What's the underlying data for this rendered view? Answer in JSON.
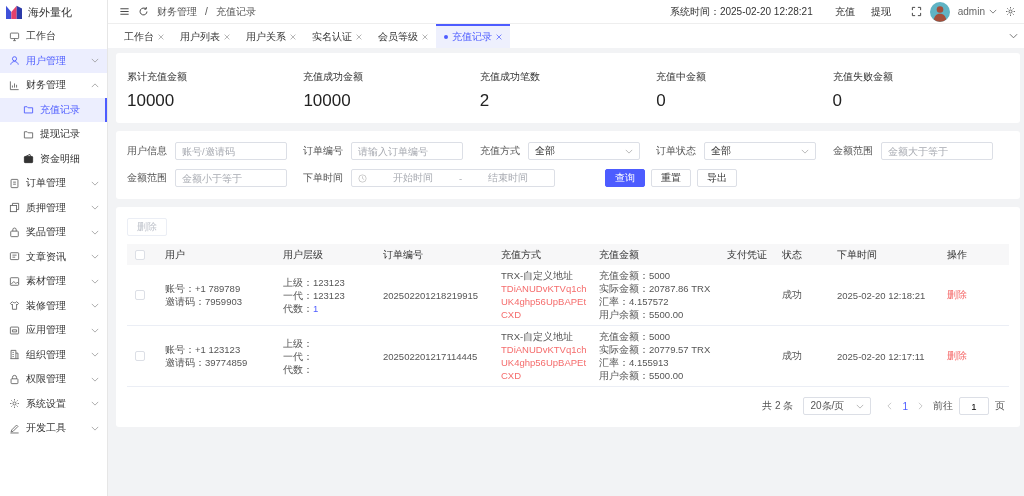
{
  "app": {
    "name": "海外量化"
  },
  "sidebar": {
    "items": [
      {
        "label": "工作台",
        "kind": "link",
        "selected": false,
        "hovered": false
      },
      {
        "label": "用户管理",
        "kind": "group",
        "selected": false,
        "hovered": true,
        "expanded": false
      },
      {
        "label": "财务管理",
        "kind": "group",
        "selected": false,
        "hovered": false,
        "expanded": true,
        "children": [
          {
            "label": "充值记录",
            "selected": true
          },
          {
            "label": "提现记录",
            "selected": false
          },
          {
            "label": "资金明细",
            "selected": false
          }
        ]
      },
      {
        "label": "订单管理",
        "kind": "group",
        "selected": false,
        "hovered": false,
        "expanded": false
      },
      {
        "label": "质押管理",
        "kind": "group",
        "selected": false,
        "hovered": false,
        "expanded": false
      },
      {
        "label": "奖品管理",
        "kind": "group",
        "selected": false,
        "hovered": false,
        "expanded": false
      },
      {
        "label": "文章资讯",
        "kind": "group",
        "selected": false,
        "hovered": false,
        "expanded": false
      },
      {
        "label": "素材管理",
        "kind": "group",
        "selected": false,
        "hovered": false,
        "expanded": false
      },
      {
        "label": "装修管理",
        "kind": "group",
        "selected": false,
        "hovered": false,
        "expanded": false
      },
      {
        "label": "应用管理",
        "kind": "group",
        "selected": false,
        "hovered": false,
        "expanded": false
      },
      {
        "label": "组织管理",
        "kind": "group",
        "selected": false,
        "hovered": false,
        "expanded": false
      },
      {
        "label": "权限管理",
        "kind": "group",
        "selected": false,
        "hovered": false,
        "expanded": false
      },
      {
        "label": "系统设置",
        "kind": "group",
        "selected": false,
        "hovered": false,
        "expanded": false
      },
      {
        "label": "开发工具",
        "kind": "group",
        "selected": false,
        "hovered": false,
        "expanded": false
      }
    ]
  },
  "header": {
    "breadcrumb": [
      "财务管理",
      "/",
      "充值记录"
    ],
    "system_time": "系统时间：2025-02-20 12:28:21",
    "links": [
      "充值",
      "提现"
    ],
    "user": "admin"
  },
  "tabs": [
    {
      "label": "工作台",
      "selected": false
    },
    {
      "label": "用户列表",
      "selected": false
    },
    {
      "label": "用户关系",
      "selected": false
    },
    {
      "label": "实名认证",
      "selected": false
    },
    {
      "label": "会员等级",
      "selected": false
    },
    {
      "label": "充值记录",
      "selected": true
    }
  ],
  "stats": [
    {
      "label": "累计充值金额",
      "value": "10000"
    },
    {
      "label": "充值成功金额",
      "value": "10000"
    },
    {
      "label": "充值成功笔数",
      "value": "2"
    },
    {
      "label": "充值中金额",
      "value": "0"
    },
    {
      "label": "充值失败金额",
      "value": "0"
    }
  ],
  "filters": {
    "row_1": [
      {
        "label": "用户信息",
        "kind": "input",
        "placeholder": "账号/邀请码"
      },
      {
        "label": "订单编号",
        "kind": "input",
        "placeholder": "请输入订单编号"
      },
      {
        "label": "充值方式",
        "kind": "select",
        "value": "全部"
      },
      {
        "label": "订单状态",
        "kind": "select",
        "value": "全部"
      },
      {
        "label": "金额范围",
        "kind": "input",
        "placeholder": "金额大于等于"
      }
    ],
    "row_2": [
      {
        "label": "金额范围",
        "kind": "input",
        "placeholder": "金额小于等于"
      },
      {
        "label": "下单时间",
        "kind": "daterange",
        "start_placeholder": "开始时间",
        "separator": "-",
        "end_placeholder": "结束时间"
      }
    ],
    "buttons": [
      {
        "label": "查询",
        "kind": "primary"
      },
      {
        "label": "重置",
        "kind": "default"
      },
      {
        "label": "导出",
        "kind": "default"
      }
    ]
  },
  "table": {
    "delete_button": {
      "label": "删除",
      "disabled": true
    },
    "select_all": {
      "checked": false
    },
    "columns": [
      "用户",
      "用户层级",
      "订单编号",
      "充值方式",
      "充值金额",
      "支付凭证",
      "状态",
      "下单时间",
      "操作"
    ],
    "rows": [
      {
        "checked": false,
        "user": [
          "账号：+1 789789",
          "邀请码：7959903"
        ],
        "level": [
          {
            "label": "上级：",
            "value": "123123",
            "kind": "text"
          },
          {
            "label": "一代：",
            "value": "123123",
            "kind": "text"
          },
          {
            "label": "代数：",
            "value": "1",
            "kind": "link"
          }
        ],
        "order_no": "202502201218219915",
        "method": "TRX-自定义地址",
        "address": [
          "TDiANUDvKTVq1ch",
          "UK4ghp56UpBAPEt",
          "CXD"
        ],
        "amount": [
          "充值金额：5000",
          "实际金额：20787.86 TRX",
          "汇率：4.157572",
          "用户余额：5500.00"
        ],
        "status": "成功",
        "time": "2025-02-20 12:18:21",
        "action": "删除"
      },
      {
        "checked": false,
        "user": [
          "账号：+1 123123",
          "邀请码：39774859"
        ],
        "level": [
          {
            "label": "上级："
          },
          {
            "label": "一代："
          },
          {
            "label": "代数："
          }
        ],
        "order_no": "202502201217114445",
        "method": "TRX-自定义地址",
        "address": [
          "TDiANUDvKTVq1ch",
          "UK4ghp56UpBAPEt",
          "CXD"
        ],
        "amount": [
          "充值金额：5000",
          "实际金额：20779.57 TRX",
          "汇率：4.155913",
          "用户余额：5500.00"
        ],
        "status": "成功",
        "time": "2025-02-20 12:17:11",
        "action": "删除"
      }
    ]
  },
  "pagination": {
    "total": "共 2 条",
    "page_size": "20条/页",
    "pages": [
      {
        "label": "1",
        "selected": true
      }
    ],
    "goto_label": "前往",
    "goto_value": "1",
    "goto_suffix": "页"
  }
}
